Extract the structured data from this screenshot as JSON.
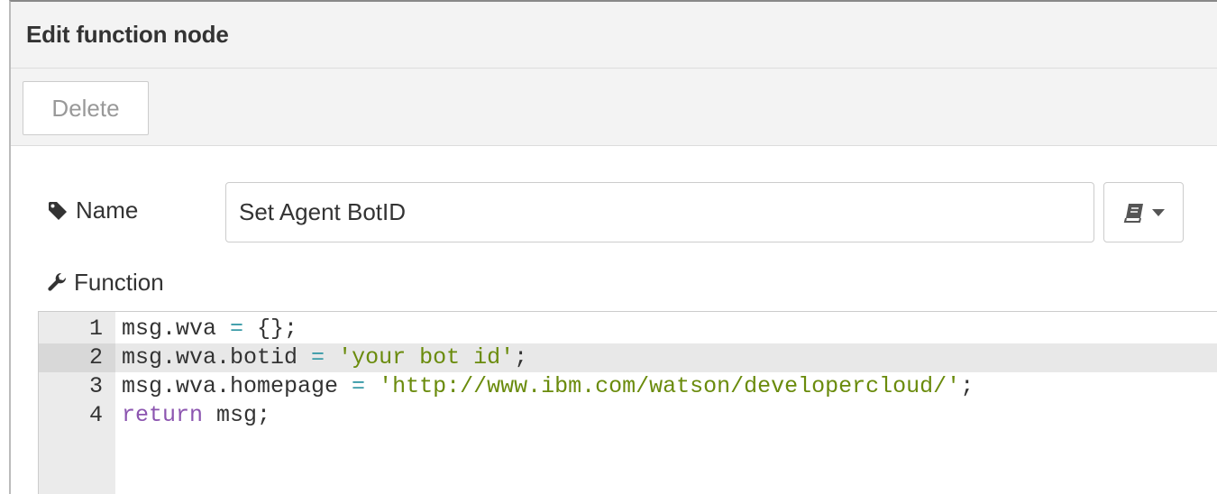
{
  "dialog": {
    "title": "Edit function node",
    "delete_label": "Delete"
  },
  "form": {
    "name_label": "Name",
    "name_value": "Set Agent BotID",
    "function_label": "Function"
  },
  "editor": {
    "active_line": 2,
    "lines": [
      {
        "num": "1",
        "tokens": [
          {
            "t": "msg.wva ",
            "c": ""
          },
          {
            "t": "=",
            "c": "op"
          },
          {
            "t": " {};",
            "c": ""
          }
        ]
      },
      {
        "num": "2",
        "tokens": [
          {
            "t": "msg.wva.botid ",
            "c": ""
          },
          {
            "t": "=",
            "c": "op"
          },
          {
            "t": " ",
            "c": ""
          },
          {
            "t": "'your bot id'",
            "c": "str"
          },
          {
            "t": ";",
            "c": ""
          }
        ]
      },
      {
        "num": "3",
        "tokens": [
          {
            "t": "msg.wva.homepage ",
            "c": ""
          },
          {
            "t": "=",
            "c": "op"
          },
          {
            "t": " ",
            "c": ""
          },
          {
            "t": "'http://www.ibm.com/watson/developercloud/'",
            "c": "str"
          },
          {
            "t": ";",
            "c": ""
          }
        ]
      },
      {
        "num": "4",
        "tokens": [
          {
            "t": "return",
            "c": "kw"
          },
          {
            "t": " msg;",
            "c": ""
          }
        ]
      }
    ]
  },
  "icons": {
    "name": "tag-icon",
    "function": "wrench-icon",
    "library": "book-icon",
    "dropdown": "caret-down-icon"
  }
}
